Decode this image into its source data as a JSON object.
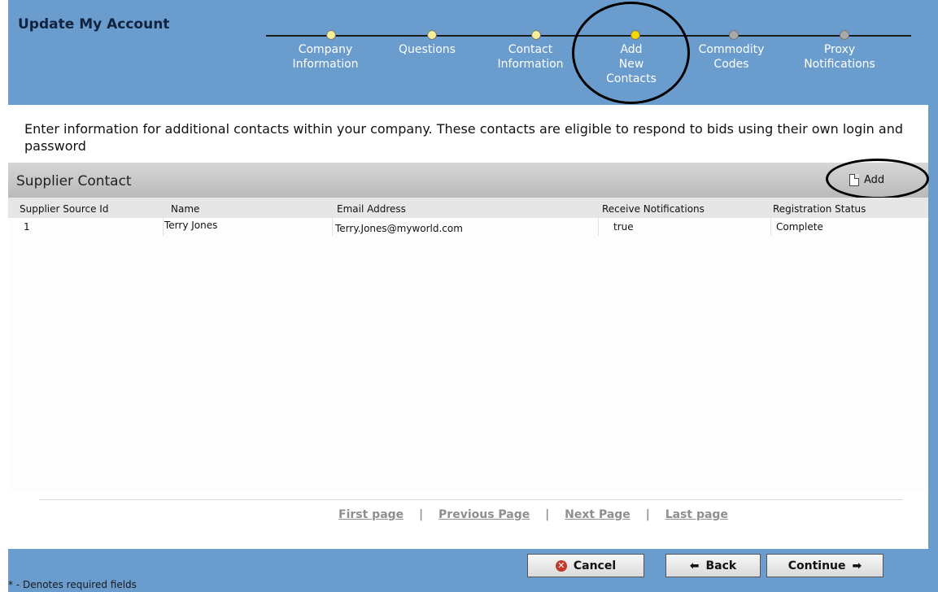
{
  "header": {
    "title": "Update My Account"
  },
  "steps": [
    {
      "label": "Company\nInformation",
      "status": "done"
    },
    {
      "label": "Questions",
      "status": "done"
    },
    {
      "label": "Contact\nInformation",
      "status": "done"
    },
    {
      "label": "Add\nNew\nContacts",
      "status": "active"
    },
    {
      "label": "Commodity\nCodes",
      "status": "todo"
    },
    {
      "label": "Proxy\nNotifications",
      "status": "todo"
    }
  ],
  "intro_text": "Enter information for additional contacts within your company. These contacts are eligible to respond to bids using their own login and password",
  "section": {
    "title": "Supplier Contact",
    "add_label": "Add"
  },
  "table": {
    "columns": [
      "Supplier Source Id",
      "Name",
      "Email Address",
      "Receive Notifications",
      "Registration Status"
    ],
    "rows": [
      [
        "1",
        "Terry Jones",
        "Terry.Jones@myworld.com",
        "true",
        "Complete"
      ]
    ]
  },
  "pager": {
    "first": "First page",
    "previous": "Previous Page",
    "next": "Next Page",
    "last": "Last page",
    "separator": "|"
  },
  "buttons": {
    "cancel": "Cancel",
    "back": "Back",
    "continue": "Continue"
  },
  "footnote": "* - Denotes required fields",
  "colors": {
    "frame": "#6a9ccd",
    "active_step": "#f5d800",
    "done_step": "#f3ef9a",
    "todo_step": "#a9a9a9"
  }
}
